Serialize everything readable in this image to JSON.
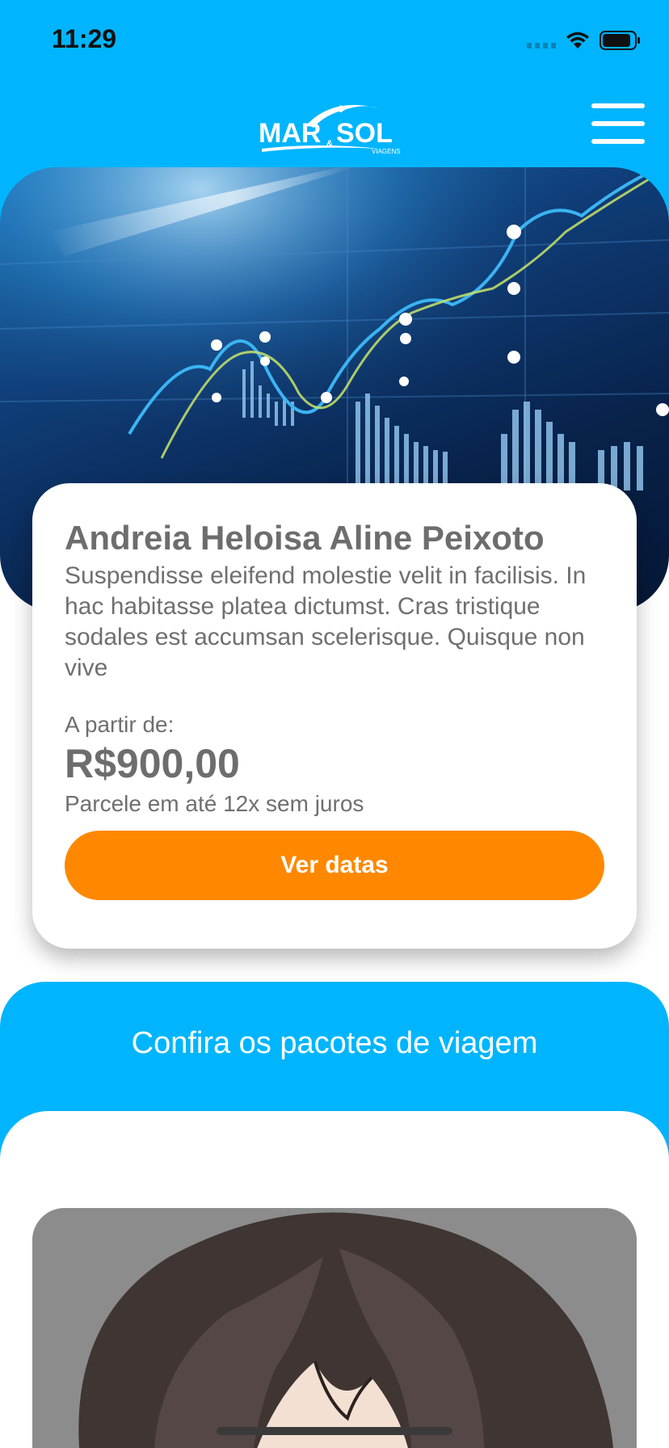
{
  "status_bar": {
    "time": "11:29"
  },
  "header": {
    "logo_text_left": "MAR",
    "logo_ampersand": "&",
    "logo_text_right": "SOL",
    "logo_subtext": "VIAGENS",
    "menu_icon": "hamburger-menu-icon"
  },
  "featured": {
    "title": "Andreia Heloisa Aline Peixoto",
    "description": "Suspendisse eleifend molestie velit in facilisis. In hac habitasse platea dictumst. Cras tristique sodales est accumsan scelerisque. Quisque non vive",
    "from_label": "A partir de:",
    "price": "R$900,00",
    "installments": "Parcele em até 12x sem juros",
    "cta_label": "Ver datas"
  },
  "packages": {
    "section_title": "Confira os pacotes de viagem"
  },
  "colors": {
    "brand_blue": "#00b5fd",
    "cta_orange": "#ff8800",
    "text_gray": "#6d6d6d"
  }
}
